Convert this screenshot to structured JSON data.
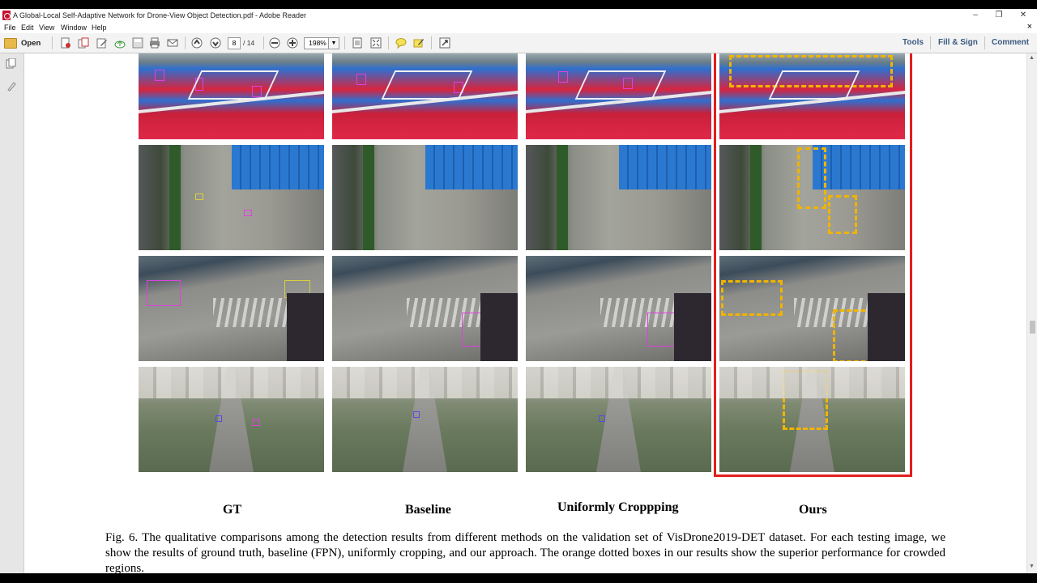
{
  "window": {
    "title": "A Global-Local Self-Adaptive Network for Drone-View Object Detection.pdf - Adobe Reader",
    "controls": {
      "minimize": "–",
      "restore": "❐",
      "close": "✕"
    }
  },
  "menu": {
    "items": [
      "File",
      "Edit",
      "View",
      "Window",
      "Help"
    ],
    "close_doc": "×"
  },
  "toolbar": {
    "open_label": "Open",
    "page_current": "8",
    "page_total": "/ 14",
    "zoom": "198%",
    "right_tabs": [
      "Tools",
      "Fill & Sign",
      "Comment"
    ]
  },
  "figure": {
    "column_labels": [
      "GT",
      "Baseline",
      "Uniformly Croppping",
      "Ours"
    ],
    "caption": "Fig. 6.   The qualitative comparisons among the detection results from different methods on the validation set of VisDrone2019-DET dataset. For each testing image, we show the results of ground truth, baseline (FPN), uniformly cropping, and our approach. The orange dotted boxes in our results show the superior performance for crowded regions."
  },
  "colors": {
    "highlight_frame": "#e41e1e",
    "dotted_boxes": "#f0b400",
    "detection_magenta": "#e040e0"
  }
}
